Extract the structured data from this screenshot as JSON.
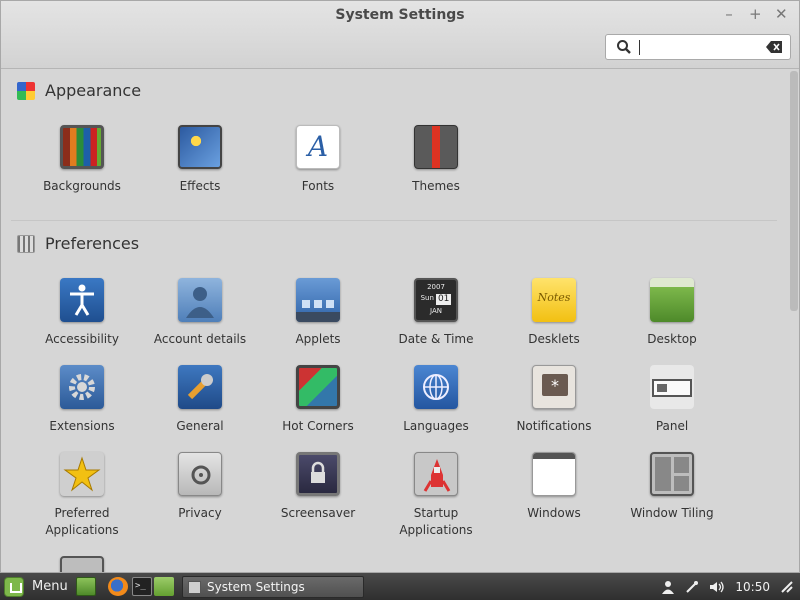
{
  "window": {
    "title": "System Settings",
    "minimize_glyph": "–",
    "maximize_glyph": "+",
    "close_glyph": "✕"
  },
  "search": {
    "placeholder": "",
    "value": ""
  },
  "sections": {
    "appearance": {
      "title": "Appearance",
      "icon": "appearance-color-icon",
      "items": [
        {
          "label": "Backgrounds",
          "icon": "backgrounds-icon"
        },
        {
          "label": "Effects",
          "icon": "effects-icon"
        },
        {
          "label": "Fonts",
          "icon": "fonts-icon",
          "glyph": "A"
        },
        {
          "label": "Themes",
          "icon": "themes-icon"
        }
      ]
    },
    "preferences": {
      "title": "Preferences",
      "icon": "preferences-icon",
      "items": [
        {
          "label": "Accessibility",
          "icon": "accessibility-icon"
        },
        {
          "label": "Account details",
          "icon": "account-details-icon"
        },
        {
          "label": "Applets",
          "icon": "applets-icon"
        },
        {
          "label": "Date & Time",
          "icon": "date-time-icon",
          "year": "2007",
          "day": "Sun",
          "date": "01",
          "month": "JAN"
        },
        {
          "label": "Desklets",
          "icon": "desklets-icon",
          "note": "Notes"
        },
        {
          "label": "Desktop",
          "icon": "desktop-icon"
        },
        {
          "label": "Extensions",
          "icon": "extensions-icon"
        },
        {
          "label": "General",
          "icon": "general-icon"
        },
        {
          "label": "Hot Corners",
          "icon": "hot-corners-icon"
        },
        {
          "label": "Languages",
          "icon": "languages-icon"
        },
        {
          "label": "Notifications",
          "icon": "notifications-icon",
          "glyph": "*"
        },
        {
          "label": "Panel",
          "icon": "panel-icon"
        },
        {
          "label": "Preferred\nApplications",
          "icon": "preferred-applications-icon"
        },
        {
          "label": "Privacy",
          "icon": "privacy-icon"
        },
        {
          "label": "Screensaver",
          "icon": "screensaver-icon"
        },
        {
          "label": "Startup\nApplications",
          "icon": "startup-applications-icon"
        },
        {
          "label": "Windows",
          "icon": "windows-icon"
        },
        {
          "label": "Window Tiling",
          "icon": "window-tiling-icon"
        },
        {
          "label": "",
          "icon": "workspaces-icon"
        }
      ]
    }
  },
  "taskbar": {
    "menu_label": "Menu",
    "window_button_label": "System Settings",
    "clock": "10:50",
    "launchers": [
      "show-desktop-icon",
      "firefox-icon",
      "terminal-icon",
      "files-icon"
    ],
    "tray": [
      "user-icon",
      "network-icon",
      "volume-icon",
      "clock",
      "power-icon"
    ]
  },
  "colors": {
    "window_bg": "#d6d6d6",
    "taskbar_bg": "#3b3b3b",
    "mint_green": "#7eb84b"
  }
}
